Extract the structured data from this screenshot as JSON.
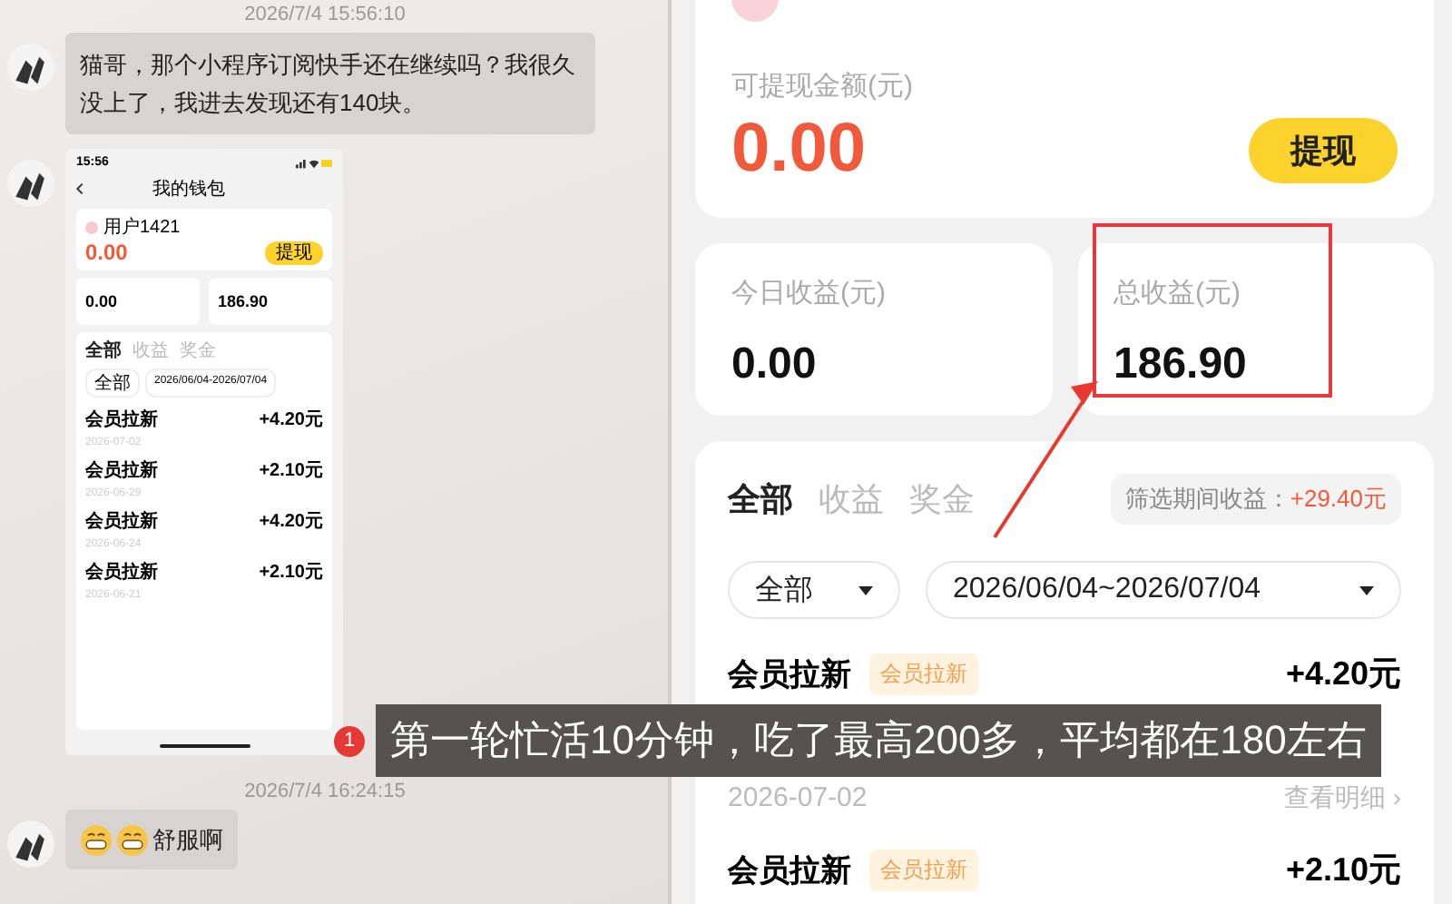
{
  "chat": {
    "messages": [
      {
        "kind": "time",
        "text": "2026/7/4 15:56:10"
      },
      {
        "kind": "text",
        "text": "猫哥，那个小程序订阅快手还在继续吗？我很久没上了，我进去发现还有140块。"
      },
      {
        "kind": "image",
        "screenshot": {
          "status_time": "15:56",
          "title": "我的钱包",
          "user": "用户1421",
          "balance": "0.00",
          "withdraw": "提现",
          "today": "0.00",
          "total": "186.90",
          "tabs": [
            {
              "label": "全部",
              "selected": true
            },
            {
              "label": "收益",
              "selected": false
            },
            {
              "label": "奖金",
              "selected": false
            }
          ],
          "filter": "全部",
          "date_range": "2026/06/04-2026/07/04",
          "records": [
            {
              "name": "会员拉新",
              "amount": "+4.20元",
              "date": "2026-07-02"
            },
            {
              "name": "会员拉新",
              "amount": "+2.10元",
              "date": "2026-06-29"
            },
            {
              "name": "会员拉新",
              "amount": "+4.20元",
              "date": "2026-06-24"
            },
            {
              "name": "会员拉新",
              "amount": "+2.10元",
              "date": "2026-06-21"
            }
          ]
        }
      },
      {
        "kind": "time",
        "text": "2026/7/4 16:24:15"
      },
      {
        "kind": "emoji_text",
        "text": "舒服啊"
      }
    ]
  },
  "wallet": {
    "balance_label": "可提现金额(元)",
    "balance": "0.00",
    "withdraw": "提现",
    "stats": [
      {
        "label": "今日收益(元)",
        "value": "0.00",
        "highlighted": false
      },
      {
        "label": "总收益(元)",
        "value": "186.90",
        "highlighted": true
      }
    ],
    "tabs": [
      {
        "label": "全部",
        "selected": true
      },
      {
        "label": "收益",
        "selected": false
      },
      {
        "label": "奖金",
        "selected": false
      }
    ],
    "period_label": "筛选期间收益：",
    "period_value": "+29.40元",
    "filter": "全部",
    "date_range": "2026/06/04~2026/07/04",
    "records": [
      {
        "name": "会员拉新",
        "tag": "会员拉新",
        "amount": "+4.20元",
        "date": "2026-07-02",
        "detail": "查看明细 ›"
      },
      {
        "name": "会员拉新",
        "tag": "会员拉新",
        "amount": "+2.10元"
      }
    ]
  },
  "caption": {
    "badge": "1",
    "text": "第一轮忙活10分钟，吃了最高200多，平均都在180左右"
  }
}
